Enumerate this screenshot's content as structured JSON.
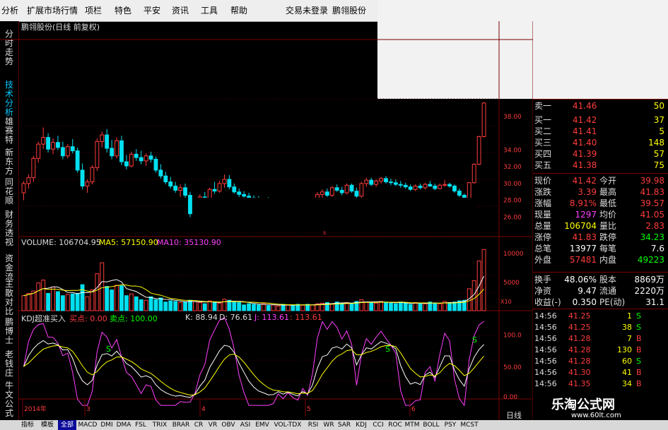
{
  "menu": [
    "分析",
    "扩展市场行情",
    "项栏",
    "特色",
    "平安",
    "资讯",
    "工具",
    "帮助",
    "交易未登录",
    "鹏翎股份"
  ],
  "vtabs": [
    {
      "label": "分时走势",
      "active": false
    },
    {
      "label": "技术分析",
      "active": true
    },
    {
      "label": "雄赛特",
      "active": false
    },
    {
      "label": "新东方",
      "active": false
    },
    {
      "label": "同花顺",
      "active": false
    },
    {
      "label": "财务透视",
      "active": false
    },
    {
      "label": "资金流",
      "active": false
    },
    {
      "label": "主散对比",
      "active": false
    },
    {
      "label": "鹏博士",
      "active": false
    },
    {
      "label": "老钱庄",
      "active": false
    },
    {
      "label": "牛文公式",
      "active": false
    }
  ],
  "chart_title": "鹏翎股份(日线 前复权)",
  "volume_legend": {
    "vol": "VOLUME: 106704.95",
    "ma5": "MA5: 57150.90",
    "ma10": "MA10: 35130.90"
  },
  "kdj_legend": {
    "name": "KDJ超准买入",
    "buy": "买点: 0.00",
    "sell": "卖点: 100.00",
    "k": "K: 88.94",
    "d": "D: 76.61",
    "j": "J: 113.61",
    "j2": ": 113.61"
  },
  "colors": {
    "up": "#ff3c3c",
    "down": "#00e0f0",
    "border": "#7a0000",
    "yellow": "#ffff00",
    "green": "#00ff00",
    "magenta": "#ff40ff",
    "white": "#ffffff"
  },
  "x_dates": [
    "2014年",
    "3",
    "4",
    "5",
    "6"
  ],
  "price_ticks": [
    "38.00",
    "34.00",
    "32.00",
    "30.00",
    "28.00",
    "26.00"
  ],
  "vol_ticks": [
    "10000",
    "5000",
    "X10"
  ],
  "kdj_ticks": [
    "100.0",
    "50.00",
    "0.00"
  ],
  "kdj_markers": [
    "S",
    "S",
    "S"
  ],
  "chart_data": {
    "type": "candlestick",
    "title": "鹏翎股份(日线 前复权)",
    "price_ylim": [
      24,
      40
    ],
    "ohlc": [
      [
        28.8,
        30.2,
        27.9,
        29.9
      ],
      [
        29.9,
        31.0,
        29.3,
        30.6
      ],
      [
        30.6,
        33.2,
        30.1,
        32.9
      ],
      [
        32.9,
        34.9,
        32.4,
        34.6
      ],
      [
        34.6,
        36.6,
        34.0,
        35.4
      ],
      [
        35.4,
        35.9,
        33.6,
        34.0
      ],
      [
        34.0,
        35.3,
        33.4,
        34.8
      ],
      [
        34.8,
        35.6,
        33.9,
        34.2
      ],
      [
        34.2,
        34.9,
        32.8,
        33.2
      ],
      [
        33.2,
        34.6,
        32.9,
        34.3
      ],
      [
        34.3,
        35.2,
        33.5,
        33.8
      ],
      [
        33.8,
        34.2,
        31.2,
        31.5
      ],
      [
        31.5,
        32.3,
        29.2,
        29.6
      ],
      [
        29.6,
        30.4,
        28.8,
        30.1
      ],
      [
        30.1,
        32.1,
        29.8,
        31.8
      ],
      [
        31.8,
        35.3,
        31.4,
        34.9
      ],
      [
        34.9,
        36.1,
        34.2,
        35.7
      ],
      [
        35.7,
        36.4,
        33.6,
        34.1
      ],
      [
        34.1,
        35.1,
        32.8,
        33.2
      ],
      [
        33.2,
        35.4,
        32.9,
        35.0
      ],
      [
        35.0,
        35.6,
        32.1,
        32.5
      ],
      [
        32.5,
        33.3,
        31.6,
        32.0
      ],
      [
        32.0,
        33.7,
        31.8,
        33.4
      ],
      [
        33.4,
        34.0,
        32.6,
        33.0
      ],
      [
        33.0,
        33.8,
        32.2,
        32.6
      ],
      [
        32.6,
        33.5,
        32.0,
        33.2
      ],
      [
        33.2,
        33.7,
        32.4,
        32.8
      ],
      [
        32.8,
        33.1,
        31.2,
        31.5
      ],
      [
        31.5,
        32.2,
        30.5,
        30.8
      ],
      [
        30.8,
        31.3,
        29.8,
        30.1
      ],
      [
        30.1,
        30.7,
        29.3,
        29.6
      ],
      [
        29.6,
        30.1,
        28.8,
        29.1
      ],
      [
        29.1,
        29.8,
        28.3,
        29.4
      ],
      [
        29.4,
        29.9,
        28.2,
        28.5
      ],
      [
        28.5,
        28.9,
        25.9,
        26.3
      ],
      [
        26.3,
        27.6,
        26.0,
        27.2
      ],
      [
        27.2,
        28.6,
        26.9,
        28.3
      ],
      [
        28.3,
        28.9,
        27.6,
        28.1
      ],
      [
        28.1,
        29.4,
        27.9,
        29.2
      ],
      [
        29.2,
        30.1,
        28.7,
        29.0
      ],
      [
        29.0,
        30.2,
        28.8,
        29.9
      ],
      [
        29.9,
        31.0,
        29.4,
        30.4
      ],
      [
        30.4,
        30.9,
        29.2,
        29.5
      ],
      [
        29.5,
        29.9,
        28.7,
        28.9
      ],
      [
        28.9,
        29.3,
        28.3,
        28.6
      ],
      [
        28.6,
        29.0,
        28.1,
        28.4
      ],
      [
        28.4,
        28.8,
        27.9,
        28.2
      ],
      [
        28.2,
        28.5,
        27.8,
        28.0
      ],
      [
        28.0,
        28.4,
        27.6,
        27.8
      ],
      [
        27.8,
        28.2,
        27.5,
        27.9
      ],
      [
        27.9,
        28.3,
        27.4,
        27.6
      ],
      [
        27.6,
        28.0,
        27.3,
        27.7
      ],
      [
        27.7,
        28.1,
        27.5,
        27.8
      ],
      [
        27.8,
        28.1,
        27.4,
        27.6
      ],
      [
        27.6,
        28.0,
        27.3,
        27.7
      ],
      [
        27.7,
        28.0,
        27.4,
        27.6
      ],
      [
        27.6,
        27.9,
        27.3,
        27.5
      ],
      [
        27.5,
        27.8,
        27.2,
        27.6
      ],
      [
        27.6,
        27.9,
        27.3,
        27.4
      ],
      [
        27.4,
        27.8,
        27.2,
        27.6
      ],
      [
        27.6,
        28.9,
        27.5,
        28.6
      ],
      [
        28.6,
        29.2,
        28.2,
        28.9
      ],
      [
        28.9,
        29.3,
        28.3,
        28.5
      ],
      [
        28.5,
        29.6,
        28.3,
        29.4
      ],
      [
        29.4,
        29.8,
        28.9,
        29.1
      ],
      [
        29.1,
        29.5,
        28.5,
        28.8
      ],
      [
        28.8,
        29.9,
        28.6,
        29.7
      ],
      [
        29.7,
        29.9,
        28.8,
        29.0
      ],
      [
        29.0,
        29.4,
        28.2,
        28.4
      ],
      [
        28.4,
        30.1,
        28.2,
        29.9
      ],
      [
        29.9,
        30.6,
        29.5,
        30.3
      ],
      [
        30.3,
        30.6,
        29.6,
        29.8
      ],
      [
        29.8,
        30.4,
        29.5,
        30.2
      ],
      [
        30.2,
        30.7,
        29.9,
        30.5
      ],
      [
        30.5,
        30.8,
        29.9,
        30.1
      ],
      [
        30.1,
        30.5,
        29.7,
        30.0
      ],
      [
        30.0,
        30.4,
        29.6,
        29.8
      ],
      [
        29.8,
        30.2,
        29.4,
        29.7
      ],
      [
        29.7,
        30.0,
        29.3,
        29.5
      ],
      [
        29.5,
        29.8,
        29.0,
        29.2
      ],
      [
        29.2,
        29.8,
        29.0,
        29.6
      ],
      [
        29.6,
        29.9,
        29.2,
        29.4
      ],
      [
        29.4,
        30.0,
        29.2,
        29.8
      ],
      [
        29.8,
        30.2,
        29.5,
        29.6
      ],
      [
        29.6,
        29.9,
        29.1,
        29.3
      ],
      [
        29.3,
        29.9,
        29.2,
        29.7
      ],
      [
        29.7,
        30.3,
        29.5,
        29.8
      ],
      [
        29.8,
        30.0,
        29.4,
        29.6
      ],
      [
        29.6,
        29.8,
        28.8,
        29.0
      ],
      [
        29.0,
        29.3,
        28.3,
        28.5
      ],
      [
        28.5,
        28.7,
        27.9,
        28.1
      ],
      [
        28.1,
        30.1,
        28.0,
        30.0
      ],
      [
        30.0,
        32.3,
        29.9,
        32.2
      ],
      [
        32.2,
        35.6,
        32.1,
        35.5
      ],
      [
        35.5,
        39.6,
        35.4,
        39.5
      ]
    ],
    "volume": [
      2600,
      3000,
      3400,
      4800,
      5300,
      3000,
      4100,
      3300,
      2600,
      2800,
      2900,
      3000,
      4500,
      2400,
      3600,
      6400,
      8300,
      4200,
      3600,
      4400,
      4300,
      2600,
      2900,
      2400,
      1900,
      1800,
      2400,
      1900,
      2200,
      1500,
      1700,
      1600,
      1400,
      1500,
      1800,
      1600,
      1400,
      1200,
      1700,
      1500,
      1300,
      2000,
      1800,
      1600,
      1400,
      1000,
      1200,
      1100,
      1000,
      1200,
      900,
      1000,
      800,
      1100,
      1000,
      900,
      1100,
      950,
      1100,
      1000,
      1200,
      1300,
      1400,
      1200,
      1500,
      1300,
      1400,
      1200,
      1600,
      1900,
      1500,
      1400,
      1300,
      1600,
      1500,
      1300,
      1200,
      1500,
      1300,
      1100,
      1400,
      1300,
      1200,
      1500,
      1300,
      1200,
      1600,
      1400,
      1500,
      1700,
      1800,
      3800,
      5200,
      8600,
      10600
    ],
    "vol_ylim": [
      0,
      11000
    ],
    "kdj_ylim": [
      0,
      120
    ]
  },
  "quote": {
    "asks": [
      {
        "label": "卖一",
        "price": "41.46",
        "vol": "50"
      }
    ],
    "bids": [
      {
        "label": "买一",
        "price": "41.42",
        "vol": "37"
      },
      {
        "label": "买二",
        "price": "41.41",
        "vol": "5"
      },
      {
        "label": "买三",
        "price": "41.40",
        "vol": "148"
      },
      {
        "label": "买四",
        "price": "41.39",
        "vol": "57"
      },
      {
        "label": "买五",
        "price": "41.38",
        "vol": "75"
      }
    ],
    "stats": [
      {
        "l1": "现价",
        "v1": "41.42",
        "l2": "今开",
        "v2": "39.98",
        "c1": "#ff3c3c",
        "c2": "#ff3c3c"
      },
      {
        "l1": "涨跌",
        "v1": "3.39",
        "l2": "最高",
        "v2": "41.83",
        "c1": "#ff3c3c",
        "c2": "#ff3c3c"
      },
      {
        "l1": "涨幅",
        "v1": "8.91%",
        "l2": "最低",
        "v2": "39.57",
        "c1": "#ff3c3c",
        "c2": "#ff3c3c"
      },
      {
        "l1": "现量",
        "v1": "1297",
        "l2": "均价",
        "v2": "41.05",
        "c1": "#ff40ff",
        "c2": "#ff3c3c"
      },
      {
        "l1": "总量",
        "v1": "106704",
        "l2": "量比",
        "v2": "2.83",
        "c1": "#ffff00",
        "c2": "#ff3c3c"
      },
      {
        "l1": "涨停",
        "v1": "41.83",
        "l2": "跌停",
        "v2": "34.23",
        "c1": "#ff3c3c",
        "c2": "#00ff00"
      },
      {
        "l1": "总笔",
        "v1": "13977",
        "l2": "每笔",
        "v2": "7.6",
        "c1": "#ffffff",
        "c2": "#ffffff"
      },
      {
        "l1": "外盘",
        "v1": "57481",
        "l2": "内盘",
        "v2": "49223",
        "c1": "#ff3c3c",
        "c2": "#00ff00"
      }
    ],
    "fund": [
      {
        "l1": "换手",
        "v1": "48.06%",
        "l2": "股本",
        "v2": "8869万"
      },
      {
        "l1": "净资",
        "v1": "9.47",
        "l2": "流通",
        "v2": "2220万"
      },
      {
        "l1": "收益(-)",
        "v1": "0.350",
        "l2": "PE(动)",
        "v2": "31.1"
      }
    ]
  },
  "ticks": [
    {
      "time": "14:56",
      "price": "41.25",
      "vol": "1",
      "bs": "S"
    },
    {
      "time": "14:56",
      "price": "41.25",
      "vol": "38",
      "bs": "S"
    },
    {
      "time": "14:56",
      "price": "41.28",
      "vol": "7",
      "bs": "B"
    },
    {
      "time": "14:56",
      "price": "41.28",
      "vol": "130",
      "bs": "B"
    },
    {
      "time": "14:56",
      "price": "41.28",
      "vol": "60",
      "bs": "S"
    },
    {
      "time": "14:56",
      "price": "41.30",
      "vol": "41",
      "bs": "B"
    },
    {
      "time": "14:56",
      "price": "41.35",
      "vol": "34",
      "bs": "B"
    }
  ],
  "period_label": "日线",
  "watermark": {
    "title": "乐淘公式网",
    "url": "www.60lt.com"
  },
  "bottom_tabs": [
    {
      "label": "指标",
      "active": false
    },
    {
      "label": "模板",
      "active": false
    },
    {
      "label": "全部",
      "active": true
    },
    {
      "label": "MACD"
    },
    {
      "label": "DMI"
    },
    {
      "label": "DMA"
    },
    {
      "label": "FSL"
    },
    {
      "label": "TRIX"
    },
    {
      "label": "BRAR"
    },
    {
      "label": "CR"
    },
    {
      "label": "VR"
    },
    {
      "label": "OBV"
    },
    {
      "label": "ASI"
    },
    {
      "label": "EMV"
    },
    {
      "label": "VOL-TDX"
    },
    {
      "label": "RSI"
    },
    {
      "label": "WR"
    },
    {
      "label": "SAR"
    },
    {
      "label": "KDJ"
    },
    {
      "label": "CCI"
    },
    {
      "label": "ROC"
    },
    {
      "label": "MTM"
    },
    {
      "label": "BOLL"
    },
    {
      "label": "PSY"
    },
    {
      "label": "MCST"
    }
  ]
}
